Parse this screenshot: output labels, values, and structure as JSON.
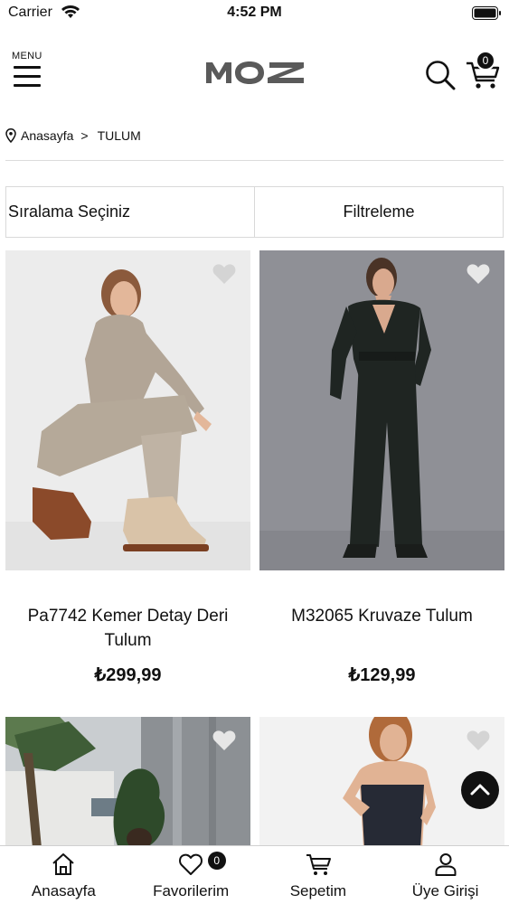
{
  "status_bar": {
    "carrier": "Carrier",
    "time": "4:52 PM"
  },
  "header": {
    "menu_label": "MENU",
    "logo_text": "MOZ",
    "cart_count": "0"
  },
  "breadcrumb": {
    "home": "Anasayfa",
    "separator": ">",
    "current": "TULUM"
  },
  "controls": {
    "sort_label": "Sıralama Seçiniz",
    "filter_label": "Filtreleme"
  },
  "products": [
    {
      "title": "Pa7742 Kemer Detay Deri Tulum",
      "price": "₺299,99"
    },
    {
      "title": "M32065 Kruvaze Tulum",
      "price": "₺129,99"
    }
  ],
  "tab_bar": {
    "home": "Anasayfa",
    "favorites": "Favorilerim",
    "favorites_count": "0",
    "cart": "Sepetim",
    "account": "Üye Girişi"
  },
  "colors": {
    "accent": "#111111",
    "divider": "#dcdcdc",
    "heart": "#d9d9d9"
  }
}
